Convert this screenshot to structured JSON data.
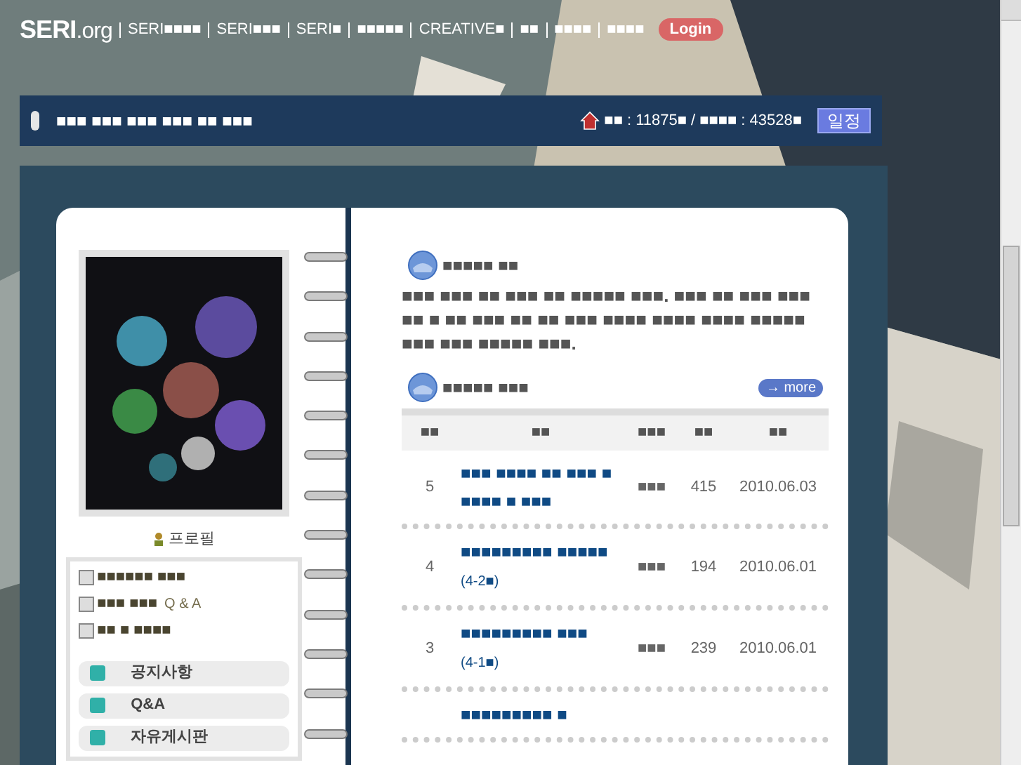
{
  "nav": {
    "logo": "SERI",
    "logo_dot": ".",
    "logo_suffix": "org",
    "links": [
      "SERI■■■■",
      "SERI■■■",
      "SERI■",
      "■■■■■",
      "CREATIVE■",
      "■■",
      "■■■■",
      "■■■■"
    ],
    "login": "Login"
  },
  "title_bar": {
    "title": "■■■ ■■■ ■■■ ■■■ ■■ ■■■",
    "today_label": "■■",
    "today_value": ": 11875■",
    "separator": "/",
    "total_label": "■■■■",
    "total_value": ": 43528■",
    "schedule_button": "일정"
  },
  "sidebar": {
    "profile_link": "프로필",
    "info": [
      {
        "text": "■■■■■■ ■■■"
      },
      {
        "text": "■■■ ■■■",
        "suffix": "Q & A"
      },
      {
        "text": "■■ ■ ■■■■"
      }
    ],
    "menu": [
      "공지사항",
      "Q&A",
      "자유게시판"
    ]
  },
  "intro": {
    "title": "■■■■■ ■■",
    "text": "■■■ ■■■ ■■ ■■■ ■■ ■■■■■ ■■■. ■■■ ■■ ■■■ ■■■ ■■ ■ ■■ ■■■ ■■ ■■ ■■■ ■■■■ ■■■■ ■■■■ ■■■■■ ■■■ ■■■ ■■■■■ ■■■."
  },
  "board": {
    "title": "■■■■■ ■■■",
    "more": "→ more",
    "columns": [
      "■■",
      "■■",
      "■■■",
      "■■",
      "■■"
    ],
    "rows": [
      {
        "number": "5",
        "title": "■■■ ■■■■ ■■ ■■■ ■■■■■ ■ ■■■",
        "writer": "■■■",
        "views": "415",
        "date": "2010.06.03"
      },
      {
        "number": "4",
        "title": "■■■■■■■■■ ■■■■■",
        "note": "(4-2■)",
        "writer": "■■■",
        "views": "194",
        "date": "2010.06.01"
      },
      {
        "number": "3",
        "title": "■■■■■■■■■ ■■■",
        "note": "(4-1■)",
        "writer": "■■■",
        "views": "239",
        "date": "2010.06.01"
      },
      {
        "title": "■■■■■■■■■ ■"
      }
    ]
  }
}
